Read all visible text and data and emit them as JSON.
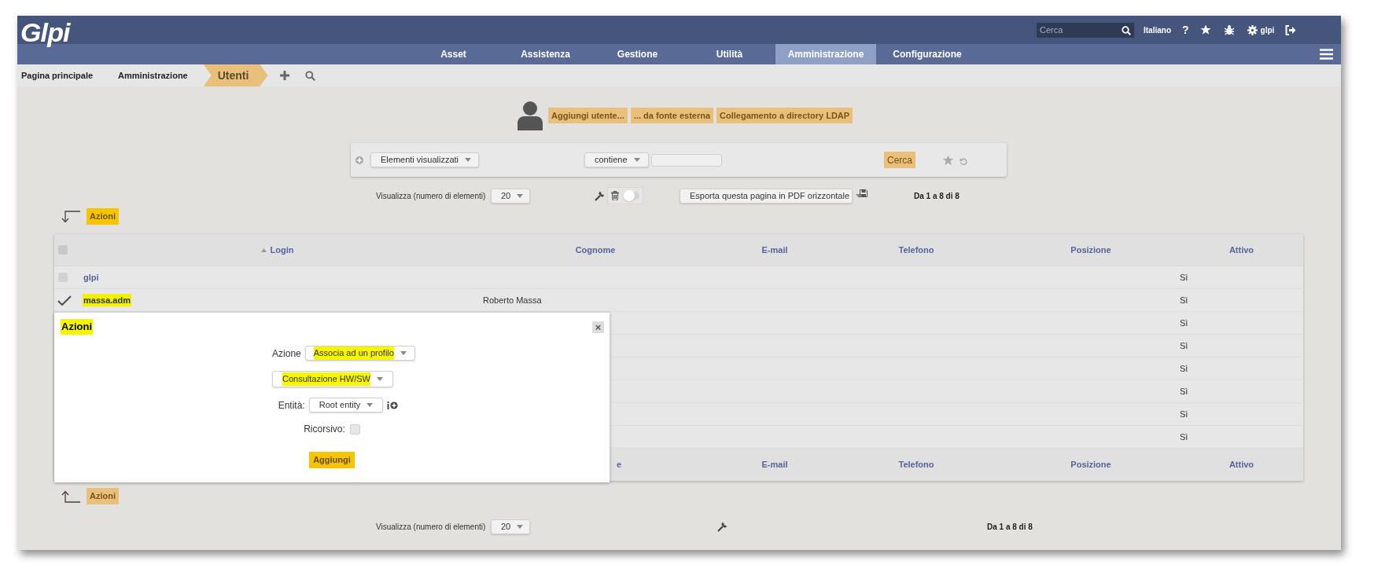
{
  "header": {
    "logo": "Glpi",
    "search": {
      "placeholder": "Cerca"
    },
    "language": "Italiano",
    "help": "?",
    "user": "glpi"
  },
  "nav": [
    {
      "label": "Asset",
      "selected": false
    },
    {
      "label": "Assistenza",
      "selected": false
    },
    {
      "label": "Gestione",
      "selected": false
    },
    {
      "label": "Utilità",
      "selected": false
    },
    {
      "label": "Amministrazione",
      "selected": true
    },
    {
      "label": "Configurazione",
      "selected": false
    }
  ],
  "breadcrumb": [
    {
      "label": "Pagina principale",
      "current": false
    },
    {
      "label": "Amministrazione",
      "current": false
    },
    {
      "label": "Utenti",
      "current": true
    }
  ],
  "add_buttons": [
    "Aggiungi utente...",
    "... da fonte esterna",
    "Collegamento a directory LDAP"
  ],
  "search": {
    "field": "Elementi visualizzati",
    "operator": "contiene",
    "button": "Cerca"
  },
  "pager_top": {
    "label": "Visualizza (numero di elementi)",
    "per_page": "20",
    "toggle_on": false,
    "export": "Esporta questa pagina in PDF orizzontale",
    "range": "Da 1 a 8 di 8"
  },
  "massive_top": {
    "label": "Azioni",
    "highlighted": true
  },
  "table": {
    "select_all_checked": false,
    "columns": [
      {
        "label": "Login",
        "sorted": true
      },
      {
        "label": "Cognome",
        "sorted": false
      },
      {
        "label": "E-mail",
        "sorted": false
      },
      {
        "label": "Telefono",
        "sorted": false
      },
      {
        "label": "Posizione",
        "sorted": false
      },
      {
        "label": "Attivo",
        "sorted": false
      }
    ],
    "rows": [
      {
        "login": "glpi",
        "checked": false,
        "highlighted": false,
        "attivo": "Sì"
      },
      {
        "login": "massa.adm",
        "checked": true,
        "highlighted": true,
        "cognome": "Roberto Massa",
        "attivo": "Sì"
      },
      {
        "attivo": "Sì"
      },
      {
        "attivo": "Sì"
      },
      {
        "attivo": "Sì"
      },
      {
        "attivo": "Sì"
      },
      {
        "attivo": "Sì"
      },
      {
        "attivo": "Sì"
      }
    ],
    "footer": [
      "e",
      "E-mail",
      "Telefono",
      "Posizione",
      "Attivo"
    ]
  },
  "dialog": {
    "title": "Azioni",
    "title_highlighted": true,
    "close": "×",
    "action_label": "Azione",
    "action": {
      "value": "Associa ad un profilo",
      "highlighted": true
    },
    "profile": {
      "value": "Consultazione HW/SW",
      "highlighted": true
    },
    "entity_label": "Entità:",
    "entity": {
      "value": "Root entity",
      "highlighted": false
    },
    "recursive_label": "Ricorsivo:",
    "recursive_checked": false,
    "submit": {
      "label": "Aggiungi",
      "highlighted": true
    }
  },
  "massive_bottom": {
    "label": "Azioni",
    "highlighted": false
  },
  "pager_bottom": {
    "label": "Visualizza (numero di elementi)",
    "per_page": "20",
    "range": "Da 1 a 8 di 8"
  }
}
